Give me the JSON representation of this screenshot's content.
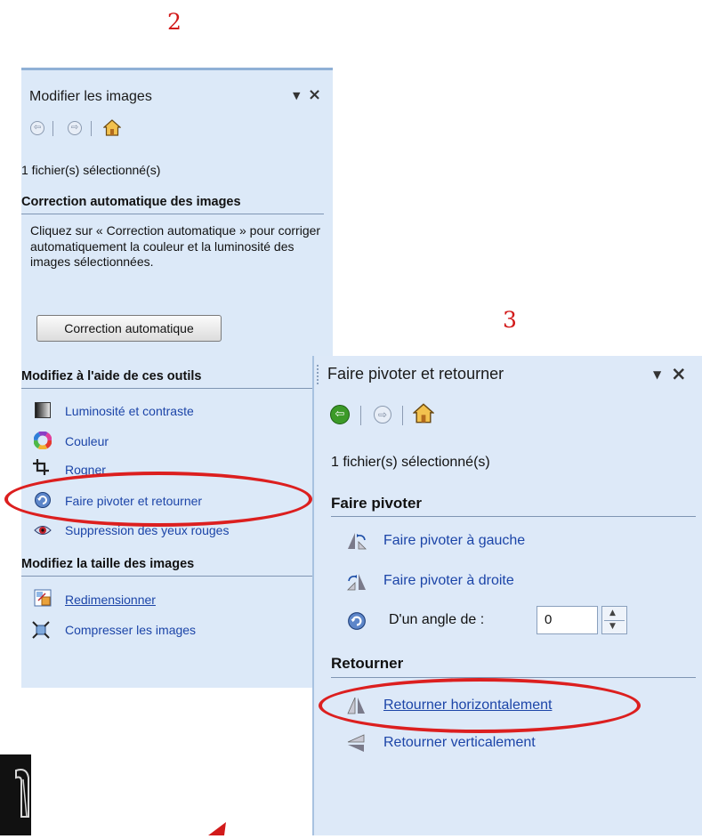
{
  "labels": {
    "step2": "2",
    "step3": "3"
  },
  "panel_edit": {
    "title": "Modifier les images",
    "selection_status": "1 fichier(s) sélectionné(s)",
    "auto_section": {
      "heading": "Correction automatique des images",
      "description": "Cliquez sur « Correction automatique » pour corriger automatiquement la couleur et la luminosité des images sélectionnées.",
      "button_label": "Correction automatique"
    },
    "tools_section": {
      "heading": "Modifiez à l'aide de ces outils",
      "items": [
        {
          "label": "Luminosité et contraste",
          "icon": "brightness-contrast-icon"
        },
        {
          "label": "Couleur",
          "icon": "color-wheel-icon"
        },
        {
          "label": "Rogner",
          "icon": "crop-icon"
        },
        {
          "label": "Faire pivoter et retourner",
          "icon": "rotate-icon"
        },
        {
          "label": "Suppression des yeux rouges",
          "icon": "red-eye-icon"
        }
      ]
    },
    "size_section": {
      "heading": "Modifiez la taille des images",
      "items": [
        {
          "label": "Redimensionner",
          "icon": "resize-icon"
        },
        {
          "label": "Compresser les images",
          "icon": "compress-icon"
        }
      ]
    }
  },
  "panel_rotate": {
    "title": "Faire pivoter et retourner",
    "selection_status": "1 fichier(s) sélectionné(s)",
    "rotate_section": {
      "heading": "Faire pivoter",
      "items": [
        {
          "label": "Faire pivoter à gauche",
          "icon": "rotate-left-icon"
        },
        {
          "label": "Faire pivoter à droite",
          "icon": "rotate-right-icon"
        }
      ],
      "angle_label": "D'un angle de :",
      "angle_value": "0"
    },
    "flip_section": {
      "heading": "Retourner",
      "items": [
        {
          "label": "Retourner horizontalement",
          "icon": "flip-horizontal-icon"
        },
        {
          "label": "Retourner verticalement",
          "icon": "flip-vertical-icon"
        }
      ]
    }
  },
  "colors": {
    "panel_bg": "#dce9f8",
    "annotation_red": "#dc1f1f",
    "link_blue": "#1c45a8",
    "step_number_red": "#d21a1a"
  }
}
